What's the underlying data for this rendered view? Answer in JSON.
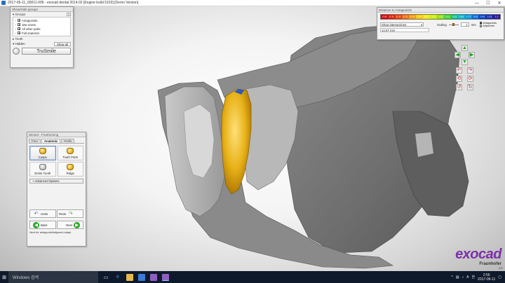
{
  "window": {
    "title": "2017-06-11_00011-005 - exocad dental 2014.02 [Engine build 5163] [Demo Version]",
    "min_icon": "minimize-icon",
    "max_icon": "maximize-icon",
    "close_icon": "close-icon",
    "min_glyph": "—",
    "max_glyph": "☐",
    "close_glyph": "✕"
  },
  "groups_panel": {
    "title": "Show/Hide groups",
    "groups_label": "Groups",
    "help_label": "?",
    "groups": [
      {
        "label": "Antagonists",
        "checked": true
      },
      {
        "label": "Jaw scans",
        "checked": true
      },
      {
        "label": "All other parts",
        "checked": true
      },
      {
        "label": "Full anatomic",
        "checked": true
      }
    ],
    "tooth_label": "Tooth",
    "hidden_label": "Hidden",
    "show_all_label": "Show all",
    "trusmile_label": "TruSmile"
  },
  "distance_panel": {
    "title": "Distance to Antagonists",
    "colorbar": {
      "ticks": [
        "-0.81",
        "-0.31",
        "-0.31",
        "-0.21",
        "-0.11",
        "0.00",
        "0.11",
        "0.21",
        "0.31",
        "0.41",
        "0.51",
        "0.61",
        "0.71",
        "0.81",
        "0.91",
        "1.01",
        "1.1"
      ],
      "colors": [
        "#d40000",
        "#e01a00",
        "#ec3a00",
        "#f26a00",
        "#f59a00",
        "#f7c700",
        "#f2e800",
        "#c8ec00",
        "#8fe000",
        "#3fd42a",
        "#00c88a",
        "#00b8d0",
        "#0096e6",
        "#0068dc",
        "#0040c8",
        "#1a2ab0",
        "#2a1a9a"
      ]
    },
    "mode_select": "Show intersections",
    "scaling_label": "Scaling",
    "scaling_level": 0.5,
    "scaling_value": "1",
    "unit": "mm",
    "chk_antagonists": "Antagonists",
    "chk_adjacents": "Adjacents",
    "readout": "14.67 mm"
  },
  "direction_pad": {
    "up_icon": "arrow-up-icon",
    "down_icon": "arrow-down-icon",
    "left_icon": "arrow-left-icon",
    "right_icon": "arrow-right-icon",
    "up": "▲",
    "down": "▼",
    "left": "◀",
    "right": "▶",
    "rot_a": "↶",
    "rot_b": "↷",
    "rot_c": "⟲",
    "rot_d": "⟳",
    "rot_e": "↺",
    "rot_f": "↻"
  },
  "wizard": {
    "title": "Wizard - Freeforming",
    "tabs": [
      "Free",
      "Anatomic",
      "Perfis"
    ],
    "active_tab": "Anatomic",
    "tools": [
      {
        "label": "Cusps",
        "selected": true,
        "icon": "gold"
      },
      {
        "label": "Tooth Parts",
        "selected": false,
        "icon": "gold"
      },
      {
        "label": "Entire Tooth",
        "selected": false,
        "icon": "grey"
      },
      {
        "label": "Ridge",
        "selected": false,
        "icon": "gold"
      }
    ],
    "advanced_label": "+ Advanced Options",
    "undo_label": "Undo",
    "redo_label": "Redo",
    "back_label": "Back",
    "next_label": "Next",
    "hint": "Next for antagonist/adjacent adapt"
  },
  "logo": {
    "brand": "exocad",
    "sub": "Fraunhofer",
    "sub2": "IGD"
  },
  "taskbar": {
    "search_placeholder": "Windows 검색",
    "time": "2:56",
    "date": "2017-06-11",
    "lang": "A",
    "ime": "한"
  },
  "colors": {
    "gold": "#e8b218",
    "model_grey": "#7d7d7d",
    "brand": "#7b2fa8"
  }
}
